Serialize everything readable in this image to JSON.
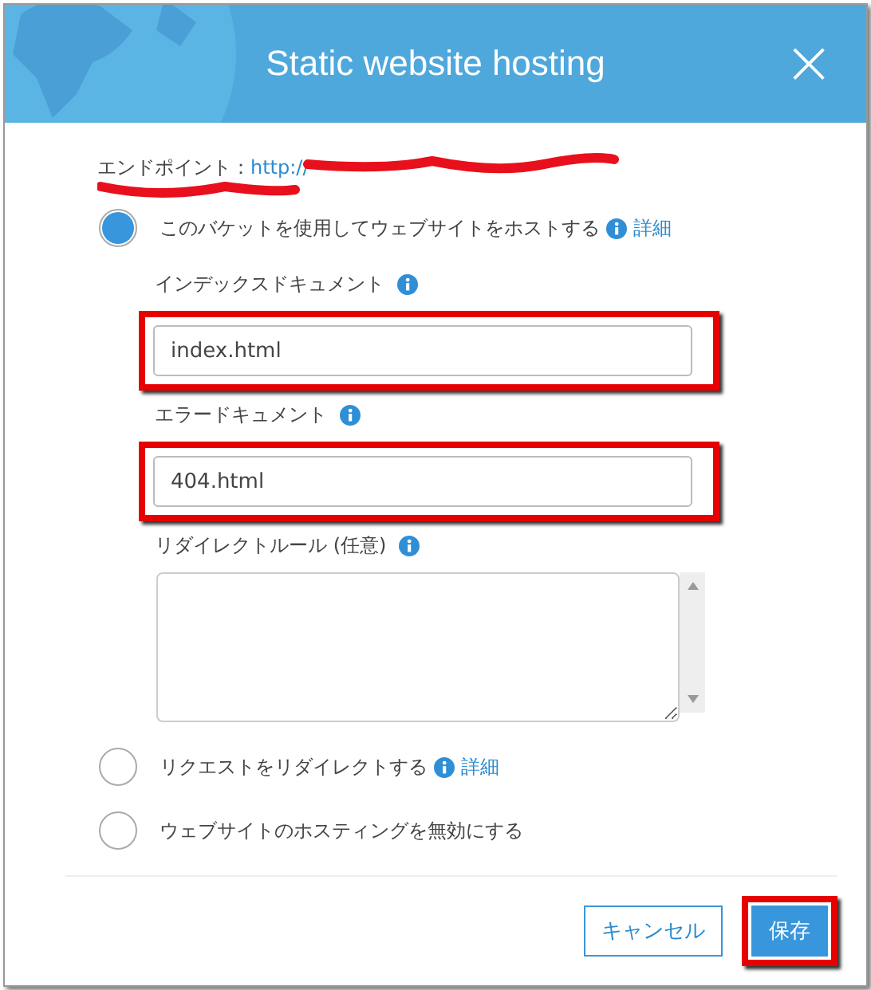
{
  "dialog": {
    "title": "Static website hosting",
    "close": "×"
  },
  "endpoint": {
    "label": "エンドポイント：",
    "url": "http://",
    "redacted": true
  },
  "options": [
    {
      "label": "このバケットを使用してウェブサイトをホストする",
      "selected": true,
      "info": true,
      "link": "詳細"
    },
    {
      "label": "リクエストをリダイレクトする",
      "selected": false,
      "info": true,
      "link": "詳細"
    },
    {
      "label": "ウェブサイトのホスティングを無効にする",
      "selected": false,
      "info": false
    }
  ],
  "fields": [
    {
      "kind": "input",
      "label": "インデックスドキュメント",
      "value": "index.html",
      "highlighted": true
    },
    {
      "kind": "input",
      "label": "エラードキュメント",
      "value": "404.html",
      "highlighted": true
    },
    {
      "kind": "textarea",
      "label": "リダイレクトルール (任意)",
      "highlighted": false
    }
  ],
  "buttons": [
    {
      "label": "キャンセル",
      "kind": "secondary",
      "highlighted": false
    },
    {
      "label": "保存",
      "kind": "primary",
      "highlighted": true
    }
  ]
}
